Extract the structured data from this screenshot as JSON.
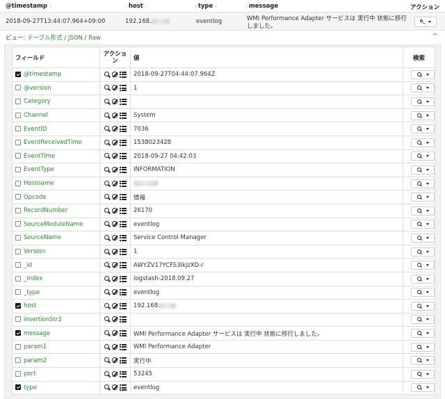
{
  "header": {
    "col_timestamp": "@timestamp",
    "col_host": "host",
    "col_type": "type",
    "col_message": "message",
    "col_action": "アクション",
    "sort_glyph": "‹"
  },
  "summary": {
    "timestamp": "2018-09-27T13:44:07.964+09:00",
    "host_prefix": "192.168.",
    "type": "eventlog",
    "message": "WMI Performance Adapter サービスは 実行中 状態に移行しました。"
  },
  "view": {
    "prefix": "ビュー: ",
    "table": "テーブル形式",
    "sep1": " / ",
    "json": "JSON",
    "sep2": " / ",
    "raw": "Raw",
    "collapse_glyph": "^"
  },
  "table": {
    "col_field": "フィールド",
    "col_action": "アクション",
    "col_value": "値",
    "col_search": "検索",
    "rows": [
      {
        "field": "@timestamp",
        "value": "2018-09-27T04:44:07.964Z",
        "checked": true
      },
      {
        "field": "@version",
        "value": "1",
        "checked": false
      },
      {
        "field": "Category",
        "value": "",
        "checked": false
      },
      {
        "field": "Channel",
        "value": "System",
        "checked": false
      },
      {
        "field": "EventID",
        "value": "7036",
        "checked": false
      },
      {
        "field": "EventReceivedTime",
        "value": "1538023428",
        "checked": false
      },
      {
        "field": "EventTime",
        "value": "2018-09-27 04:42:03",
        "checked": false
      },
      {
        "field": "EventType",
        "value": "INFORMATION",
        "checked": false
      },
      {
        "field": "Hostname",
        "value": "",
        "checked": false,
        "redacted": true
      },
      {
        "field": "Opcode",
        "value": "情報",
        "checked": false
      },
      {
        "field": "RecordNumber",
        "value": "26170",
        "checked": false
      },
      {
        "field": "SourceModuleName",
        "value": "eventlog",
        "checked": false
      },
      {
        "field": "SourceName",
        "value": "Service Control Manager",
        "checked": false
      },
      {
        "field": "Version",
        "value": "1",
        "checked": false
      },
      {
        "field": "_id",
        "value": "AWYZV17YCFS3lkjzXD-r",
        "checked": false
      },
      {
        "field": "_index",
        "value": "logstash-2018.09.27",
        "checked": false
      },
      {
        "field": "_type",
        "value": "eventlog",
        "checked": false
      },
      {
        "field": "host",
        "value": "192.168",
        "checked": true,
        "redacted": true
      },
      {
        "field": "insertionStr3",
        "value": "",
        "checked": false
      },
      {
        "field": "message",
        "value": "WMI Performance Adapter サービスは 実行中 状態に移行しました。",
        "checked": true
      },
      {
        "field": "param1",
        "value": "WMI Performance Adapter",
        "checked": false
      },
      {
        "field": "param2",
        "value": "実行中",
        "checked": false
      },
      {
        "field": "port",
        "value": "53245",
        "checked": false
      },
      {
        "field": "type",
        "value": "eventlog",
        "checked": true
      }
    ]
  },
  "colors": {
    "link": "#2a8a2a",
    "panel_bg": "#f2f2f2",
    "border": "#dddddd"
  },
  "icons": {
    "action_search": "magnifier-icon",
    "action_exclude": "ban-icon",
    "action_columns": "table-icon",
    "search_dropdown": "chevron-down-icon"
  }
}
